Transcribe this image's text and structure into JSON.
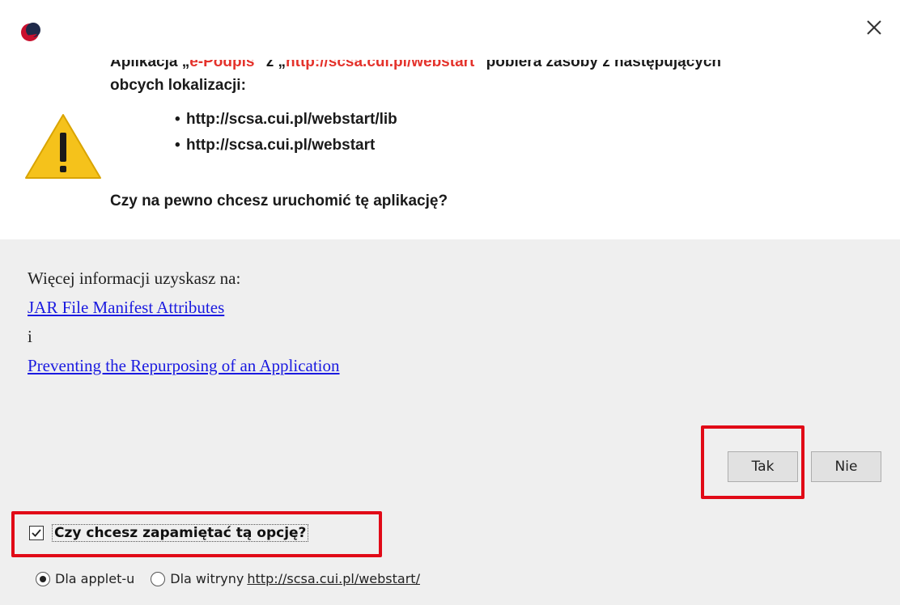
{
  "dialog": {
    "close_label": "×",
    "message": {
      "line1_prefix": "Aplikacja „",
      "app_name": "e-Podpis",
      "line1_mid": "\" z „",
      "app_url": "http://scsa.cui.pl/webstart",
      "line1_suffix": "\" pobiera zasoby z następujących",
      "line2": "obcych lokalizacji:",
      "locations": [
        "http://scsa.cui.pl/webstart/lib",
        "http://scsa.cui.pl/webstart"
      ],
      "question": "Czy na pewno chcesz uruchomić tę aplikację?"
    },
    "info": {
      "intro": "Więcej informacji uzyskasz na:",
      "link1": "JAR File Manifest Attributes",
      "conjunction": "i",
      "link2": "Preventing the Repurposing of an Application"
    },
    "buttons": {
      "yes": "Tak",
      "no": "Nie"
    },
    "remember": {
      "label": "Czy chcesz zapamiętać tą opcję?",
      "checked": true
    },
    "scope": {
      "option_applet": "Dla applet-u",
      "option_site_prefix": "Dla witryny",
      "site_url": "http://scsa.cui.pl/webstart/",
      "selected": "applet"
    },
    "colors": {
      "highlight": "#e10a17",
      "link": "#1a1ae0",
      "app_name": "#e4322b",
      "warning_fill": "#f5c21b"
    }
  }
}
